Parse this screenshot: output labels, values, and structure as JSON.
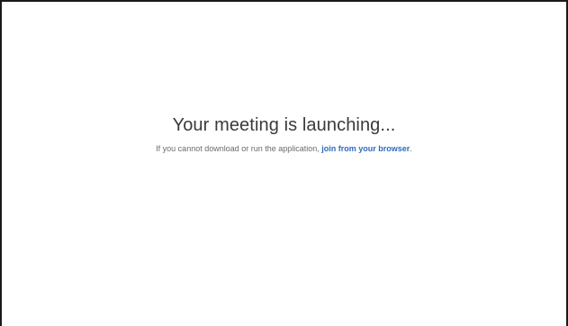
{
  "main": {
    "headline": "Your meeting is launching...",
    "instructions_prefix": "If you cannot download or run the application, ",
    "browser_link_label": "join from your browser",
    "instructions_suffix": "."
  },
  "colors": {
    "link": "#2d6cc0",
    "headline_text": "#3a3a3a",
    "body_text": "#6b6b6b",
    "border": "#1a1a1a"
  }
}
